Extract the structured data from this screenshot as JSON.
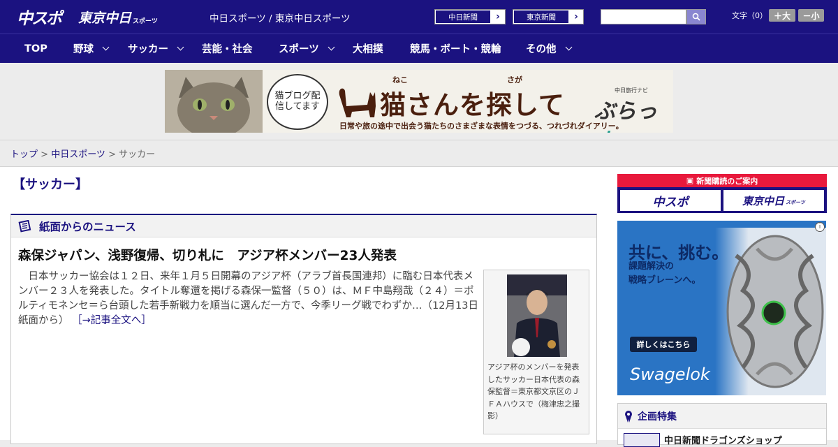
{
  "header": {
    "logo_chuspo": "中スポ",
    "logo_tokyo": "東京中日",
    "logo_tokyo_small": "スポーツ",
    "site_title": "中日スポーツ / 東京中日スポーツ",
    "ext_links": [
      {
        "label": "中日新聞"
      },
      {
        "label": "東京新聞"
      }
    ],
    "search_placeholder": "",
    "fontsize_label": "文字（0）",
    "fontsize_up": "＋大",
    "fontsize_down": "－小"
  },
  "nav": {
    "items": [
      {
        "label": "TOP",
        "dropdown": false
      },
      {
        "label": "野球",
        "dropdown": true
      },
      {
        "label": "サッカー",
        "dropdown": true
      },
      {
        "label": "芸能・社会",
        "dropdown": false
      },
      {
        "label": "スポーツ",
        "dropdown": true
      },
      {
        "label": "大相撲",
        "dropdown": false
      },
      {
        "label": "競馬・ボート・競輪",
        "dropdown": false
      },
      {
        "label": "その他",
        "dropdown": true
      }
    ]
  },
  "banner": {
    "speech": "猫ブログ配信してます",
    "title": "猫さんを探して",
    "ruby_neko": "ねこ",
    "ruby_saga": "さが",
    "subtitle": "日常や旅の途中で出会う猫たちのさまざまな表情をつづる、つれづれダイアリー。",
    "navi_label": "中日旅行ナビ",
    "brand": "ぶらっ",
    "brand_accent": "人"
  },
  "breadcrumb": {
    "top": "トップ",
    "sep1": " > ",
    "mid": "中日スポーツ",
    "sep2": " > ",
    "current": "サッカー"
  },
  "page_title": "【サッカー】",
  "news": {
    "section_title": "紙面からのニュース",
    "article_title": "森保ジャパン、浅野復帰、切り札に　アジア杯メンバー23人発表",
    "article_body": "　日本サッカー協会は１２日、来年１月５日開幕のアジア杯（アラブ首長国連邦）に臨む日本代表メンバー２３人を発表した。タイトル奪還を掲げる森保一監督（５０）は、ＭＦ中島翔哉（２４）＝ポルティモネンセ＝ら台頭した若手新戦力を順当に選んだ一方で、今季リーグ戦でわずか…（12月13日 紙面から）",
    "read_more": "［→記事全文へ］",
    "photo_caption": "アジア杯のメンバーを発表したサッカー日本代表の森保監督＝東京都文京区のＪＦＡハウスで（梅津忠之撮影）"
  },
  "sidebar": {
    "promo_title": "新聞購読のご案内",
    "promo_chuspo": "中スポ",
    "promo_tokyo": "東京中日",
    "promo_tokyo_small": "スポーツ",
    "ad_headline": "共に、挑む。",
    "ad_sub1": "課題解決の",
    "ad_sub2": "戦略ブレーンへ。",
    "ad_button": "詳しくはこちら",
    "ad_brand": "Swagelok",
    "feature_title": "企画特集",
    "feature_item": "中日新聞ドラゴンズショップ"
  },
  "colors": {
    "brand_navy": "#1b1280",
    "promo_red": "#e8193c",
    "ad_blue": "#2a74c4"
  }
}
